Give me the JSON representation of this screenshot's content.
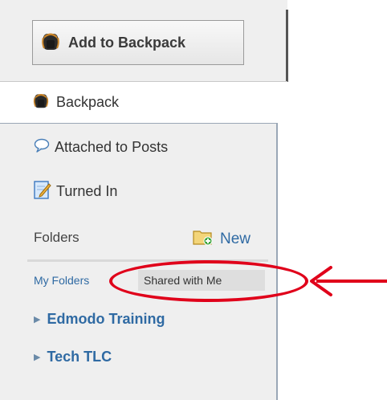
{
  "add_button": {
    "label": "Add to Backpack",
    "icon": "backpack-icon"
  },
  "backpack_tab": {
    "label": "Backpack",
    "icon": "backpack-icon"
  },
  "nav": [
    {
      "label": "Attached to Posts",
      "icon": "speech-bubble-icon"
    },
    {
      "label": "Turned In",
      "icon": "edit-document-icon"
    }
  ],
  "folders": {
    "heading": "Folders",
    "new_label": "New",
    "new_icon": "new-folder-icon",
    "tabs": {
      "my_folders": "My Folders",
      "shared": "Shared with Me"
    },
    "items": [
      {
        "label": "Edmodo Training"
      },
      {
        "label": "Tech TLC"
      }
    ]
  },
  "colors": {
    "link": "#2f6aa3",
    "annotation": "#e0001a",
    "panel": "#efefef"
  }
}
